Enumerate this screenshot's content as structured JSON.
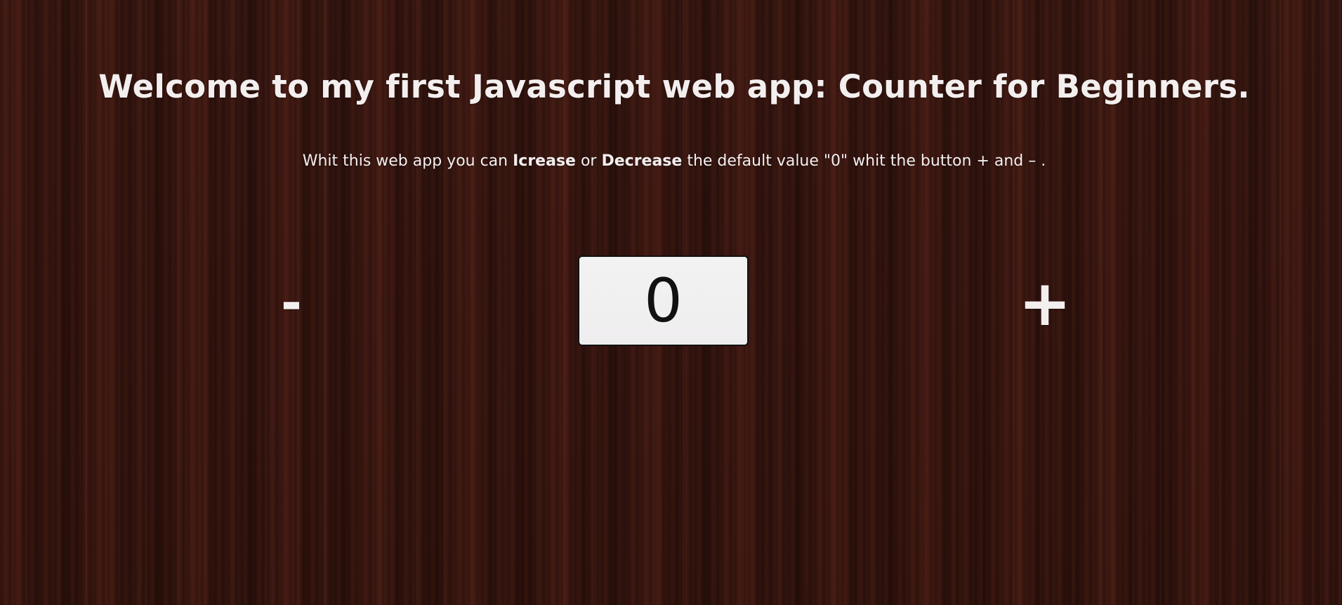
{
  "header": {
    "title": "Welcome to my first Javascript web app: Counter for Beginners."
  },
  "description": {
    "part1": "Whit this web app you can ",
    "increase_word": "Icrease",
    "part2": " or ",
    "decrease_word": "Decrease",
    "part3": " the default value \"0\" whit the button + and – ."
  },
  "counter": {
    "decrease_label": "-",
    "value": "0",
    "increase_label": "+"
  },
  "colors": {
    "background": "#3a1812",
    "text": "#f4efef",
    "counter_box": "#f0eff0",
    "counter_text": "#111111"
  }
}
